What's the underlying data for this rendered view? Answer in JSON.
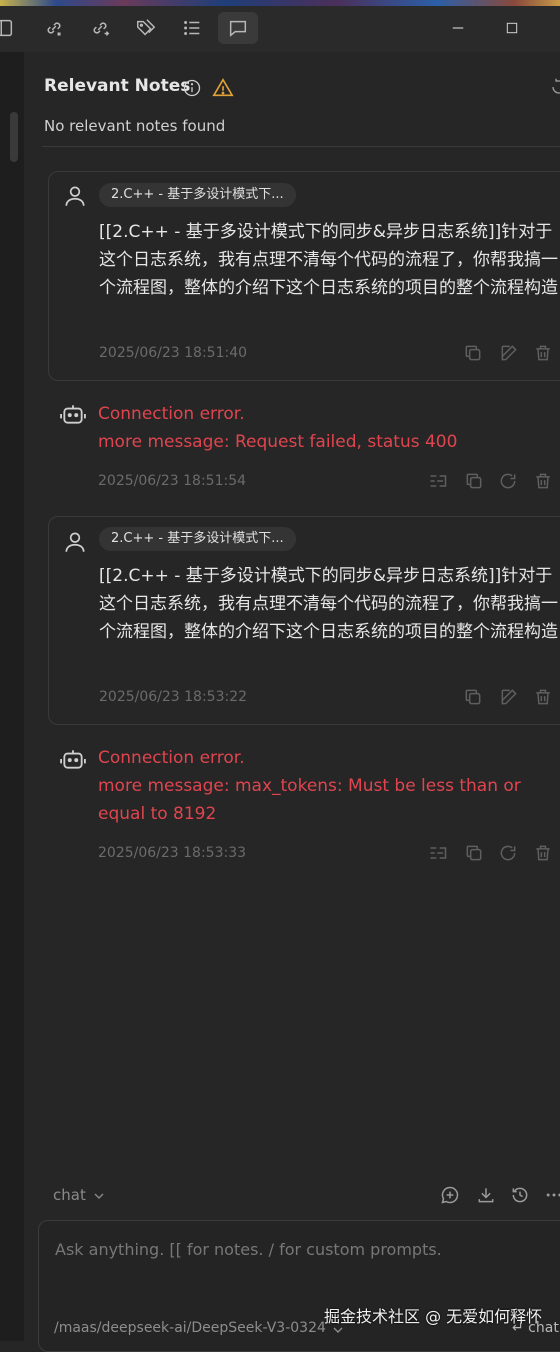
{
  "relevant": {
    "title": "Relevant Notes",
    "empty": "No relevant notes found"
  },
  "messages": [
    {
      "role": "user",
      "note_pill": "2.C++ - 基于多设计模式下...",
      "text": "[[2.C++ - 基于多设计模式下的同步&异步日志系统]]针对于这个日志系统，我有点理不清每个代码的流程了，你帮我搞一个流程图，整体的介绍下这个日志系统的项目的整个流程构造",
      "time": "2025/06/23 18:51:40"
    },
    {
      "role": "assistant",
      "error": "Connection error.",
      "detail": "more message: Request failed, status 400",
      "time": "2025/06/23 18:51:54"
    },
    {
      "role": "user",
      "note_pill": "2.C++ - 基于多设计模式下...",
      "text": "[[2.C++ - 基于多设计模式下的同步&异步日志系统]]针对于这个日志系统，我有点理不清每个代码的流程了，你帮我搞一个流程图，整体的介绍下这个日志系统的项目的整个流程构造",
      "time": "2025/06/23 18:53:22"
    },
    {
      "role": "assistant",
      "error": "Connection error.",
      "detail": "more message: max_tokens: Must be less than or equal to 8192",
      "time": "2025/06/23 18:53:33"
    }
  ],
  "bottom": {
    "mode": "chat",
    "placeholder": "Ask anything. [[ for notes. / for custom prompts.",
    "model": "/maas/deepseek-ai/DeepSeek-V3-0324",
    "send_hint": "↵ chat",
    "watermark": "掘金技术社区 @ 无爱如何释怀"
  },
  "colors": {
    "error": "#e0454f",
    "warning": "#e2a235",
    "background": "#262626"
  }
}
